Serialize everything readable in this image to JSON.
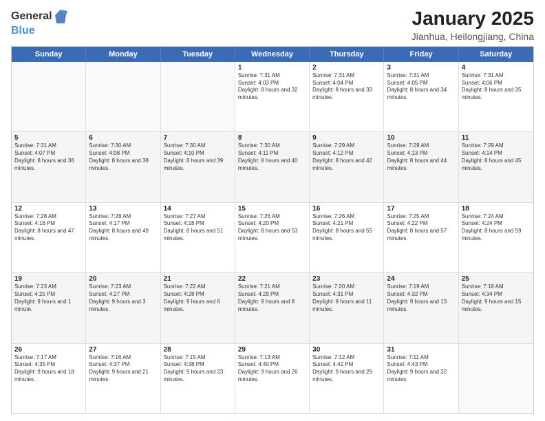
{
  "logo": {
    "general": "General",
    "blue": "Blue"
  },
  "title": {
    "month": "January 2025",
    "location": "Jianhua, Heilongjiang, China"
  },
  "headers": [
    "Sunday",
    "Monday",
    "Tuesday",
    "Wednesday",
    "Thursday",
    "Friday",
    "Saturday"
  ],
  "weeks": [
    {
      "alt": false,
      "days": [
        {
          "num": "",
          "text": ""
        },
        {
          "num": "",
          "text": ""
        },
        {
          "num": "",
          "text": ""
        },
        {
          "num": "1",
          "text": "Sunrise: 7:31 AM\nSunset: 4:03 PM\nDaylight: 8 hours and 32 minutes."
        },
        {
          "num": "2",
          "text": "Sunrise: 7:31 AM\nSunset: 4:04 PM\nDaylight: 8 hours and 33 minutes."
        },
        {
          "num": "3",
          "text": "Sunrise: 7:31 AM\nSunset: 4:05 PM\nDaylight: 8 hours and 34 minutes."
        },
        {
          "num": "4",
          "text": "Sunrise: 7:31 AM\nSunset: 4:06 PM\nDaylight: 8 hours and 35 minutes."
        }
      ]
    },
    {
      "alt": true,
      "days": [
        {
          "num": "5",
          "text": "Sunrise: 7:31 AM\nSunset: 4:07 PM\nDaylight: 8 hours and 36 minutes."
        },
        {
          "num": "6",
          "text": "Sunrise: 7:30 AM\nSunset: 4:08 PM\nDaylight: 8 hours and 38 minutes."
        },
        {
          "num": "7",
          "text": "Sunrise: 7:30 AM\nSunset: 4:10 PM\nDaylight: 8 hours and 39 minutes."
        },
        {
          "num": "8",
          "text": "Sunrise: 7:30 AM\nSunset: 4:11 PM\nDaylight: 8 hours and 40 minutes."
        },
        {
          "num": "9",
          "text": "Sunrise: 7:29 AM\nSunset: 4:12 PM\nDaylight: 8 hours and 42 minutes."
        },
        {
          "num": "10",
          "text": "Sunrise: 7:29 AM\nSunset: 4:13 PM\nDaylight: 8 hours and 44 minutes."
        },
        {
          "num": "11",
          "text": "Sunrise: 7:29 AM\nSunset: 4:14 PM\nDaylight: 8 hours and 45 minutes."
        }
      ]
    },
    {
      "alt": false,
      "days": [
        {
          "num": "12",
          "text": "Sunrise: 7:28 AM\nSunset: 4:16 PM\nDaylight: 8 hours and 47 minutes."
        },
        {
          "num": "13",
          "text": "Sunrise: 7:28 AM\nSunset: 4:17 PM\nDaylight: 8 hours and 49 minutes."
        },
        {
          "num": "14",
          "text": "Sunrise: 7:27 AM\nSunset: 4:18 PM\nDaylight: 8 hours and 51 minutes."
        },
        {
          "num": "15",
          "text": "Sunrise: 7:26 AM\nSunset: 4:20 PM\nDaylight: 8 hours and 53 minutes."
        },
        {
          "num": "16",
          "text": "Sunrise: 7:26 AM\nSunset: 4:21 PM\nDaylight: 8 hours and 55 minutes."
        },
        {
          "num": "17",
          "text": "Sunrise: 7:25 AM\nSunset: 4:22 PM\nDaylight: 8 hours and 57 minutes."
        },
        {
          "num": "18",
          "text": "Sunrise: 7:24 AM\nSunset: 4:24 PM\nDaylight: 8 hours and 59 minutes."
        }
      ]
    },
    {
      "alt": true,
      "days": [
        {
          "num": "19",
          "text": "Sunrise: 7:23 AM\nSunset: 4:25 PM\nDaylight: 9 hours and 1 minute."
        },
        {
          "num": "20",
          "text": "Sunrise: 7:23 AM\nSunset: 4:27 PM\nDaylight: 9 hours and 3 minutes."
        },
        {
          "num": "21",
          "text": "Sunrise: 7:22 AM\nSunset: 4:28 PM\nDaylight: 9 hours and 6 minutes."
        },
        {
          "num": "22",
          "text": "Sunrise: 7:21 AM\nSunset: 4:29 PM\nDaylight: 9 hours and 8 minutes."
        },
        {
          "num": "23",
          "text": "Sunrise: 7:20 AM\nSunset: 4:31 PM\nDaylight: 9 hours and 11 minutes."
        },
        {
          "num": "24",
          "text": "Sunrise: 7:19 AM\nSunset: 4:32 PM\nDaylight: 9 hours and 13 minutes."
        },
        {
          "num": "25",
          "text": "Sunrise: 7:18 AM\nSunset: 4:34 PM\nDaylight: 9 hours and 15 minutes."
        }
      ]
    },
    {
      "alt": false,
      "days": [
        {
          "num": "26",
          "text": "Sunrise: 7:17 AM\nSunset: 4:35 PM\nDaylight: 9 hours and 18 minutes."
        },
        {
          "num": "27",
          "text": "Sunrise: 7:16 AM\nSunset: 4:37 PM\nDaylight: 9 hours and 21 minutes."
        },
        {
          "num": "28",
          "text": "Sunrise: 7:15 AM\nSunset: 4:38 PM\nDaylight: 9 hours and 23 minutes."
        },
        {
          "num": "29",
          "text": "Sunrise: 7:13 AM\nSunset: 4:40 PM\nDaylight: 9 hours and 26 minutes."
        },
        {
          "num": "30",
          "text": "Sunrise: 7:12 AM\nSunset: 4:42 PM\nDaylight: 9 hours and 29 minutes."
        },
        {
          "num": "31",
          "text": "Sunrise: 7:11 AM\nSunset: 4:43 PM\nDaylight: 9 hours and 32 minutes."
        },
        {
          "num": "",
          "text": ""
        }
      ]
    }
  ]
}
